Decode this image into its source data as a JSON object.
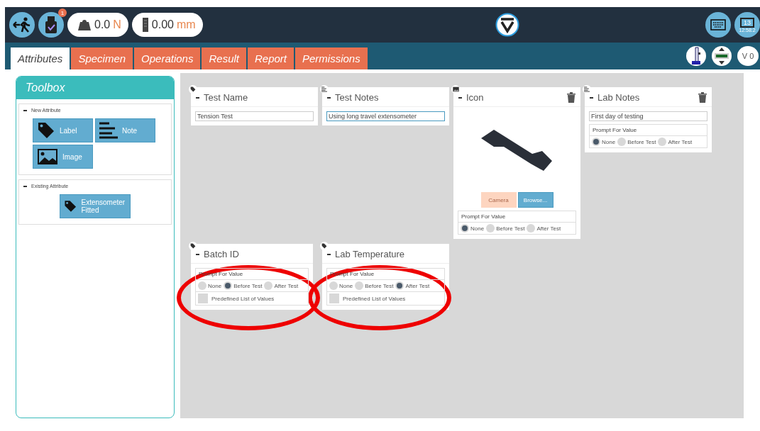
{
  "header": {
    "badge": "1",
    "force": {
      "value": "0.0",
      "unit": "N"
    },
    "extension": {
      "value": "0.00",
      "unit": "mm"
    },
    "date": "13",
    "time": "12:58:2"
  },
  "tabs": [
    {
      "label": "Attributes",
      "selected": true
    },
    {
      "label": "Specimen",
      "selected": false
    },
    {
      "label": "Operations",
      "selected": false
    },
    {
      "label": "Result",
      "selected": false
    },
    {
      "label": "Report",
      "selected": false
    },
    {
      "label": "Permissions",
      "selected": false
    }
  ],
  "version": "V 0",
  "toolbox": {
    "title": "Toolbox",
    "sections": [
      {
        "title": "New Attribute",
        "items": [
          {
            "label": "Label",
            "kind": "label"
          },
          {
            "label": "Note",
            "kind": "note"
          },
          {
            "label": "Image",
            "kind": "image"
          }
        ]
      },
      {
        "title": "Existing Attribute",
        "items": [
          {
            "label": "Extensometer Fitted",
            "kind": "label"
          }
        ]
      }
    ]
  },
  "cards": [
    {
      "kind": "label",
      "title": "Test Name",
      "deletable": false,
      "value": "Tension Test",
      "focused": false,
      "highlighted": false
    },
    {
      "kind": "note",
      "title": "Test Notes",
      "deletable": false,
      "value": "Using long travel extensometer",
      "focused": true,
      "highlighted": false
    },
    {
      "kind": "image",
      "title": "Icon",
      "deletable": true,
      "buttons": [
        {
          "label": "Camera",
          "disabled": true
        },
        {
          "label": "Browse...",
          "disabled": false
        }
      ],
      "prompt": {
        "label": "Prompt For Value",
        "options": [
          {
            "label": "None",
            "selected": true
          },
          {
            "label": "Before Test",
            "selected": false
          },
          {
            "label": "After Test",
            "selected": false
          }
        ]
      },
      "highlighted": false
    },
    {
      "kind": "note",
      "title": "Lab Notes",
      "deletable": true,
      "value": "First day of testing",
      "focused": false,
      "prompt": {
        "label": "Prompt For Value",
        "options": [
          {
            "label": "None",
            "selected": true
          },
          {
            "label": "Before Test",
            "selected": false
          },
          {
            "label": "After Test",
            "selected": false
          }
        ]
      },
      "highlighted": false
    },
    {
      "kind": "label",
      "title": "Batch ID",
      "deletable": false,
      "prompt": {
        "label": "Prompt For Value",
        "options": [
          {
            "label": "None",
            "selected": false
          },
          {
            "label": "Before Test",
            "selected": true
          },
          {
            "label": "After Test",
            "selected": false
          }
        ]
      },
      "predefined": {
        "label": "Predefined List of Values",
        "checked": false
      },
      "highlighted": true
    },
    {
      "kind": "label",
      "title": "Lab Temperature",
      "deletable": false,
      "prompt": {
        "label": "Prompt For Value",
        "options": [
          {
            "label": "None",
            "selected": false
          },
          {
            "label": "Before Test",
            "selected": false
          },
          {
            "label": "After Test",
            "selected": true
          }
        ]
      },
      "predefined": {
        "label": "Predefined List of Values",
        "checked": false
      },
      "highlighted": true
    }
  ]
}
